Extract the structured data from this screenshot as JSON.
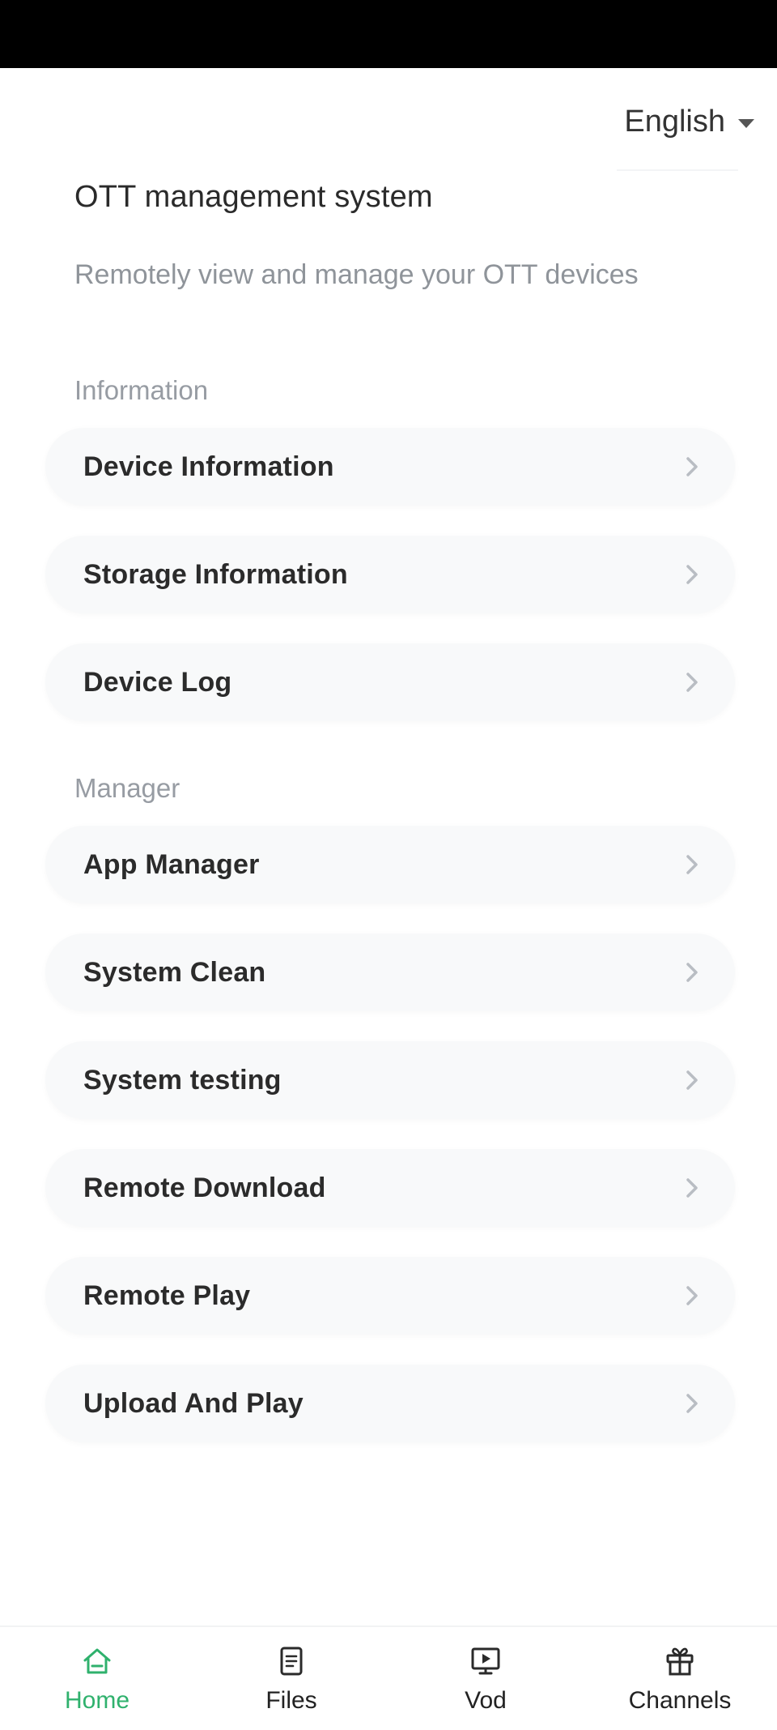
{
  "header": {
    "language": "English",
    "title": "OTT management system",
    "subtitle": "Remotely view and manage your OTT devices"
  },
  "sections": {
    "information": {
      "label": "Information",
      "items": [
        "Device Information",
        "Storage Information",
        "Device Log"
      ]
    },
    "manager": {
      "label": "Manager",
      "items": [
        "App Manager",
        "System Clean",
        "System testing",
        "Remote Download",
        "Remote Play",
        "Upload And Play"
      ]
    }
  },
  "tabs": [
    {
      "label": "Home",
      "icon": "home-icon",
      "active": true
    },
    {
      "label": "Files",
      "icon": "file-icon",
      "active": false
    },
    {
      "label": "Vod",
      "icon": "video-icon",
      "active": false
    },
    {
      "label": "Channels",
      "icon": "gift-icon",
      "active": false
    }
  ],
  "colors": {
    "accent": "#2fb16d",
    "item_background": "#f8f9fa",
    "muted_text": "#8f949a"
  }
}
